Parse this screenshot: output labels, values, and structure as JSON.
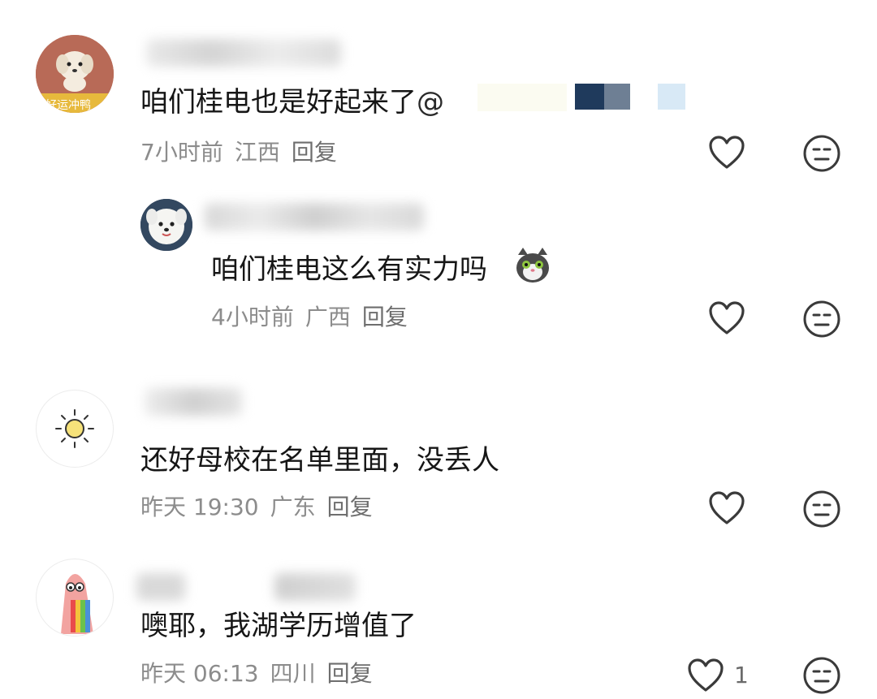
{
  "comments": [
    {
      "text": "咱们桂电也是好起来了",
      "mention_symbol": "@",
      "avatar_caption": "好运冲鸭",
      "time": "7小时前",
      "location": "江西",
      "reply_label": "回复",
      "like_count": ""
    },
    {
      "text": "咱们桂电这么有实力吗",
      "emoji": "cat-face-emoji",
      "time": "4小时前",
      "location": "广西",
      "reply_label": "回复",
      "like_count": ""
    },
    {
      "text": "还好母校在名单里面，没丢人",
      "time": "昨天 19:30",
      "location": "广东",
      "reply_label": "回复",
      "like_count": ""
    },
    {
      "text": "噢耶，我湖学历增值了",
      "time": "昨天 06:13",
      "location": "四川",
      "reply_label": "回复",
      "like_count": "1"
    }
  ],
  "icons": {
    "like": "heart-outline-icon",
    "dislike": "neutral-face-icon"
  },
  "colors": {
    "text": "#161616",
    "meta": "#8c8c8c",
    "icon": "#3a3a3a"
  }
}
